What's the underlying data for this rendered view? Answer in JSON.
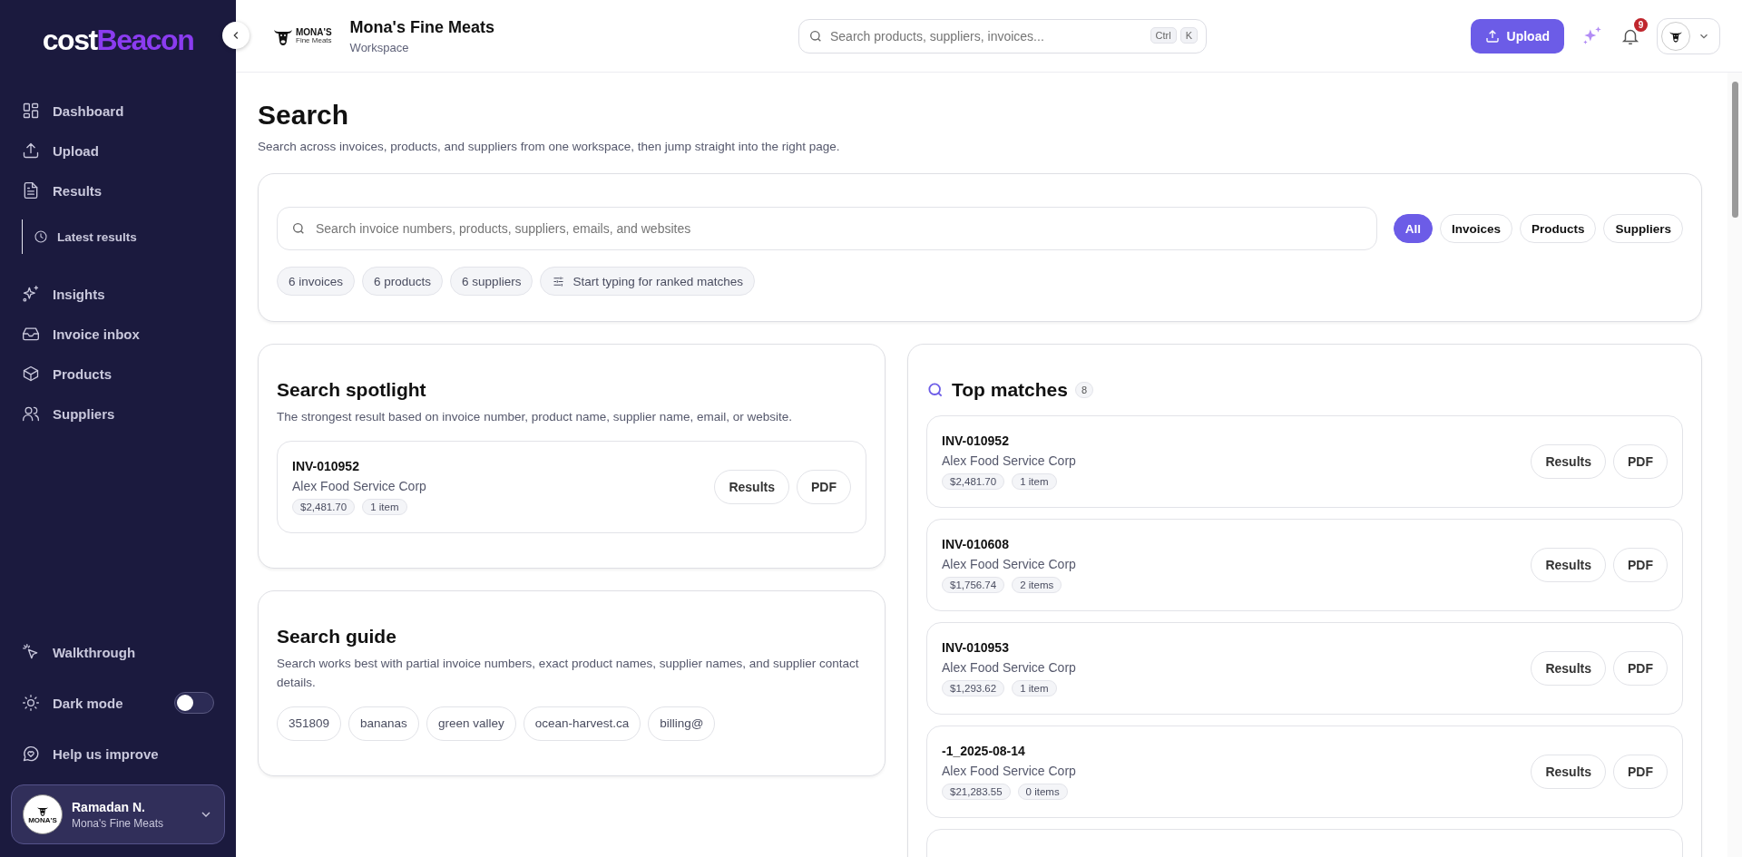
{
  "sidebar": {
    "logo": {
      "first": "cost",
      "second": "Beacon"
    },
    "items": [
      {
        "label": "Dashboard"
      },
      {
        "label": "Upload"
      },
      {
        "label": "Results",
        "children": [
          {
            "label": "Latest results"
          }
        ]
      },
      {
        "label": "Insights"
      },
      {
        "label": "Invoice inbox"
      },
      {
        "label": "Products"
      },
      {
        "label": "Suppliers"
      }
    ],
    "bottom_items": [
      {
        "label": "Walkthrough",
        "kind": "link"
      },
      {
        "label": "Dark mode",
        "kind": "toggle",
        "on": false
      },
      {
        "label": "Help us improve",
        "kind": "link"
      }
    ],
    "user": {
      "name": "Ramadan N.",
      "org": "Mona's Fine Meats",
      "avatar_text": "MONA'S"
    }
  },
  "header": {
    "brand_logo": {
      "line1": "MONA'S",
      "line2": "Fine Meats"
    },
    "workspace_name": "Mona's Fine Meats",
    "workspace_label": "Workspace",
    "search": {
      "placeholder": "Search products, suppliers, invoices...",
      "keys": [
        "Ctrl",
        "K"
      ]
    },
    "upload_button": "Upload",
    "notification_count": "9"
  },
  "page": {
    "title": "Search",
    "subtitle": "Search across invoices, products, and suppliers from one workspace, then jump straight into the right page.",
    "search_field": {
      "placeholder": "Search invoice numbers, products, suppliers, emails, and websites"
    },
    "filters": [
      {
        "label": "All",
        "selected": true
      },
      {
        "label": "Invoices",
        "selected": false
      },
      {
        "label": "Products",
        "selected": false
      },
      {
        "label": "Suppliers",
        "selected": false
      }
    ],
    "stats": [
      {
        "label": "6 invoices",
        "kind": "count"
      },
      {
        "label": "6 products",
        "kind": "count"
      },
      {
        "label": "6 suppliers",
        "kind": "count"
      },
      {
        "label": "Start typing for ranked matches",
        "kind": "hint"
      }
    ],
    "spotlight": {
      "title": "Search spotlight",
      "description": "The strongest result based on invoice number, product name, supplier name, email, or website.",
      "result": {
        "invoice": "INV-010952",
        "supplier": "Alex Food Service Corp",
        "amount": "$2,481.70",
        "items": "1 item",
        "actions": [
          "Results",
          "PDF"
        ]
      }
    },
    "guide": {
      "title": "Search guide",
      "description": "Search works best with partial invoice numbers, exact product names, supplier names, and supplier contact details.",
      "examples": [
        "351809",
        "bananas",
        "green valley",
        "ocean-harvest.ca",
        "billing@"
      ]
    },
    "top_matches": {
      "title": "Top matches",
      "count": "8",
      "results": [
        {
          "invoice": "INV-010952",
          "supplier": "Alex Food Service Corp",
          "amount": "$2,481.70",
          "items": "1 item",
          "actions": [
            "Results",
            "PDF"
          ]
        },
        {
          "invoice": "INV-010608",
          "supplier": "Alex Food Service Corp",
          "amount": "$1,756.74",
          "items": "2 items",
          "actions": [
            "Results",
            "PDF"
          ]
        },
        {
          "invoice": "INV-010953",
          "supplier": "Alex Food Service Corp",
          "amount": "$1,293.62",
          "items": "1 item",
          "actions": [
            "Results",
            "PDF"
          ]
        },
        {
          "invoice": "-1_2025-08-14",
          "supplier": "Alex Food Service Corp",
          "amount": "$21,283.55",
          "items": "0 items",
          "actions": [
            "Results",
            "PDF"
          ]
        }
      ]
    }
  }
}
